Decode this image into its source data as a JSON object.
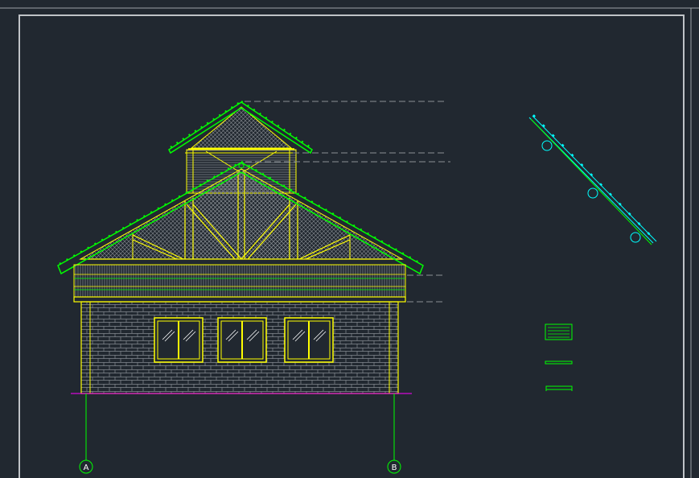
{
  "drawing": {
    "background": "#212830",
    "colors": {
      "frame": "#9aa0a6",
      "outline": "#ffff00",
      "roof": "#00ff00",
      "hatch": "#9aa0a6",
      "leader": "#8a8f95",
      "detail": "#00ffff",
      "ground": "#ff00ff"
    }
  },
  "axes": [
    {
      "id": "a",
      "label": "A"
    },
    {
      "id": "b",
      "label": "B"
    }
  ],
  "legend": {
    "items": [
      "hatched-panel-symbol",
      "roof-flashing-symbol",
      "gutter-symbol"
    ]
  }
}
